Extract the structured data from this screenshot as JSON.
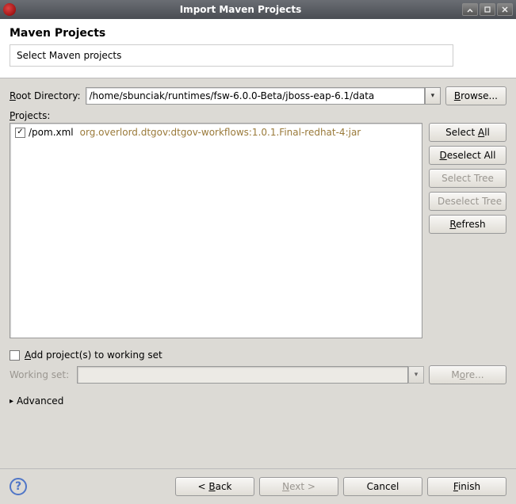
{
  "window": {
    "title": "Import Maven Projects"
  },
  "header": {
    "title": "Maven Projects",
    "subtitle": "Select Maven projects"
  },
  "rootDirectory": {
    "label_pre": "R",
    "label_post": "oot Directory:",
    "value": "/home/sbunciak/runtimes/fsw-6.0.0-Beta/jboss-eap-6.1/data",
    "browse_pre": "B",
    "browse_post": "rowse..."
  },
  "projects": {
    "label_pre": "P",
    "label_post": "rojects:",
    "items": [
      {
        "checked": true,
        "name": "/pom.xml",
        "desc": "org.overlord.dtgov:dtgov-workflows:1.0.1.Final-redhat-4:jar"
      }
    ]
  },
  "sideButtons": {
    "selectAll_pre": "Select ",
    "selectAll_u": "A",
    "selectAll_post": "ll",
    "deselectAll_pre": "D",
    "deselectAll_post": "eselect All",
    "selectTree": "Select Tree",
    "deselectTree": "Deselect Tree",
    "refresh_u": "R",
    "refresh_post": "efresh"
  },
  "workingSet": {
    "checkbox_pre": "A",
    "checkbox_post": "dd project(s) to working set",
    "checked": false,
    "label": "Working set:",
    "value": "",
    "more_pre": "M",
    "more_u": "o",
    "more_post": "re..."
  },
  "advanced": {
    "label": "Advanced"
  },
  "footer": {
    "back_pre": "< ",
    "back_u": "B",
    "back_post": "ack",
    "next_u": "N",
    "next_post": "ext >",
    "cancel": "Cancel",
    "finish_u": "F",
    "finish_post": "inish"
  }
}
